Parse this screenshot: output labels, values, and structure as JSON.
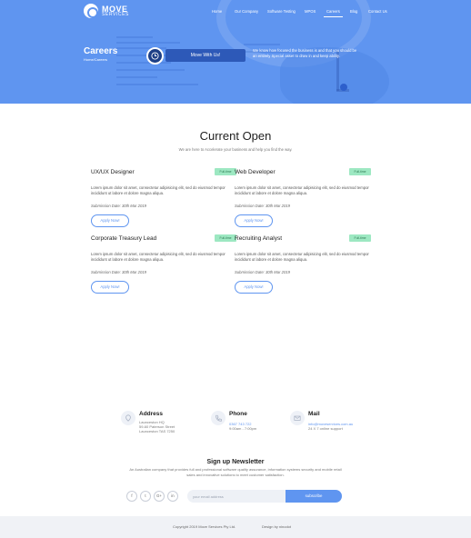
{
  "brand": {
    "name": "MOVE",
    "sub": "SERVICES"
  },
  "nav": [
    {
      "label": "Home",
      "active": false
    },
    {
      "label": "Our Company",
      "active": false
    },
    {
      "label": "Software Testing",
      "active": false
    },
    {
      "label": "MPOS",
      "active": false
    },
    {
      "label": "Careers",
      "active": true
    },
    {
      "label": "Blog",
      "active": false
    },
    {
      "label": "Contact Us",
      "active": false
    }
  ],
  "hero": {
    "title": "Careers",
    "breadcrumb": "Home/Careers",
    "move_button": "Move With Us!",
    "description": "We know how focused the business is and that you should be an entirely Special asset to draw in and keep ability."
  },
  "section": {
    "title": "Current Open",
    "subtitle": "We are here to Accelerate your business and help you find the way."
  },
  "jobs": [
    {
      "title": "UX/UX Designer",
      "badge": "Full-time",
      "description": "Lorem ipsum dolor sit amet, consectetur adipisicing elit, sed do eiusmod tempor incididunt ut labore et dolore magna aliqua.",
      "date": "Submission Date: 30th Mar 2019",
      "apply": "Apply Now!"
    },
    {
      "title": "Web Developer",
      "badge": "Full-time",
      "description": "Lorem ipsum dolor sit amet, consectetur adipisicing elit, sed do eiusmod tempor incididunt ut labore et dolore magna aliqua.",
      "date": "Submission Date: 30th Mar 2019",
      "apply": "Apply Now!"
    },
    {
      "title": "Corporate Treasury Lead",
      "badge": "Full-time",
      "description": "Lorem ipsum dolor sit amet, consectetur adipisicing elit, sed do eiusmod tempor incididunt ut labore et dolore magna aliqua.",
      "date": "Submission Date: 30th Mar 2019",
      "apply": "Apply Now!"
    },
    {
      "title": "Recruiting Analyst",
      "badge": "Full-time",
      "description": "Lorem ipsum dolor sit amet, consectetur adipisicing elit, sed do eiusmod tempor incididunt ut labore et dolore magna aliqua.",
      "date": "Submission Date: 30th Mar 2019",
      "apply": "Apply Now!"
    }
  ],
  "contact": {
    "address": {
      "label": "Address",
      "lines": [
        "Launceston HQ",
        "59-60 Paterson Street",
        "Launceston TAS 7250"
      ]
    },
    "phone": {
      "label": "Phone",
      "lines": [
        "0367 743 722",
        "9:00am - 7:00pm"
      ]
    },
    "mail": {
      "label": "Mail",
      "lines": [
        "info@moveservices.com.au",
        "24 X 7 online support"
      ]
    }
  },
  "newsletter": {
    "title": "Sign up Newsletter",
    "description": "An Australian company that provides full and professional software quality assurance, information systems security and mobile retail sales and innovative solutions to meet customer satisfaction.",
    "placeholder": "your email address",
    "button": "subscribe",
    "socials": [
      "f",
      "t",
      "G+",
      "in"
    ]
  },
  "footer": {
    "copyright": "Copyright 2019 Move Services Pty Ltd.",
    "credit": "Design by ninodot"
  },
  "colors": {
    "primary": "#5f95f0",
    "dark": "#1d3f86",
    "badge": "#9de8c2"
  }
}
